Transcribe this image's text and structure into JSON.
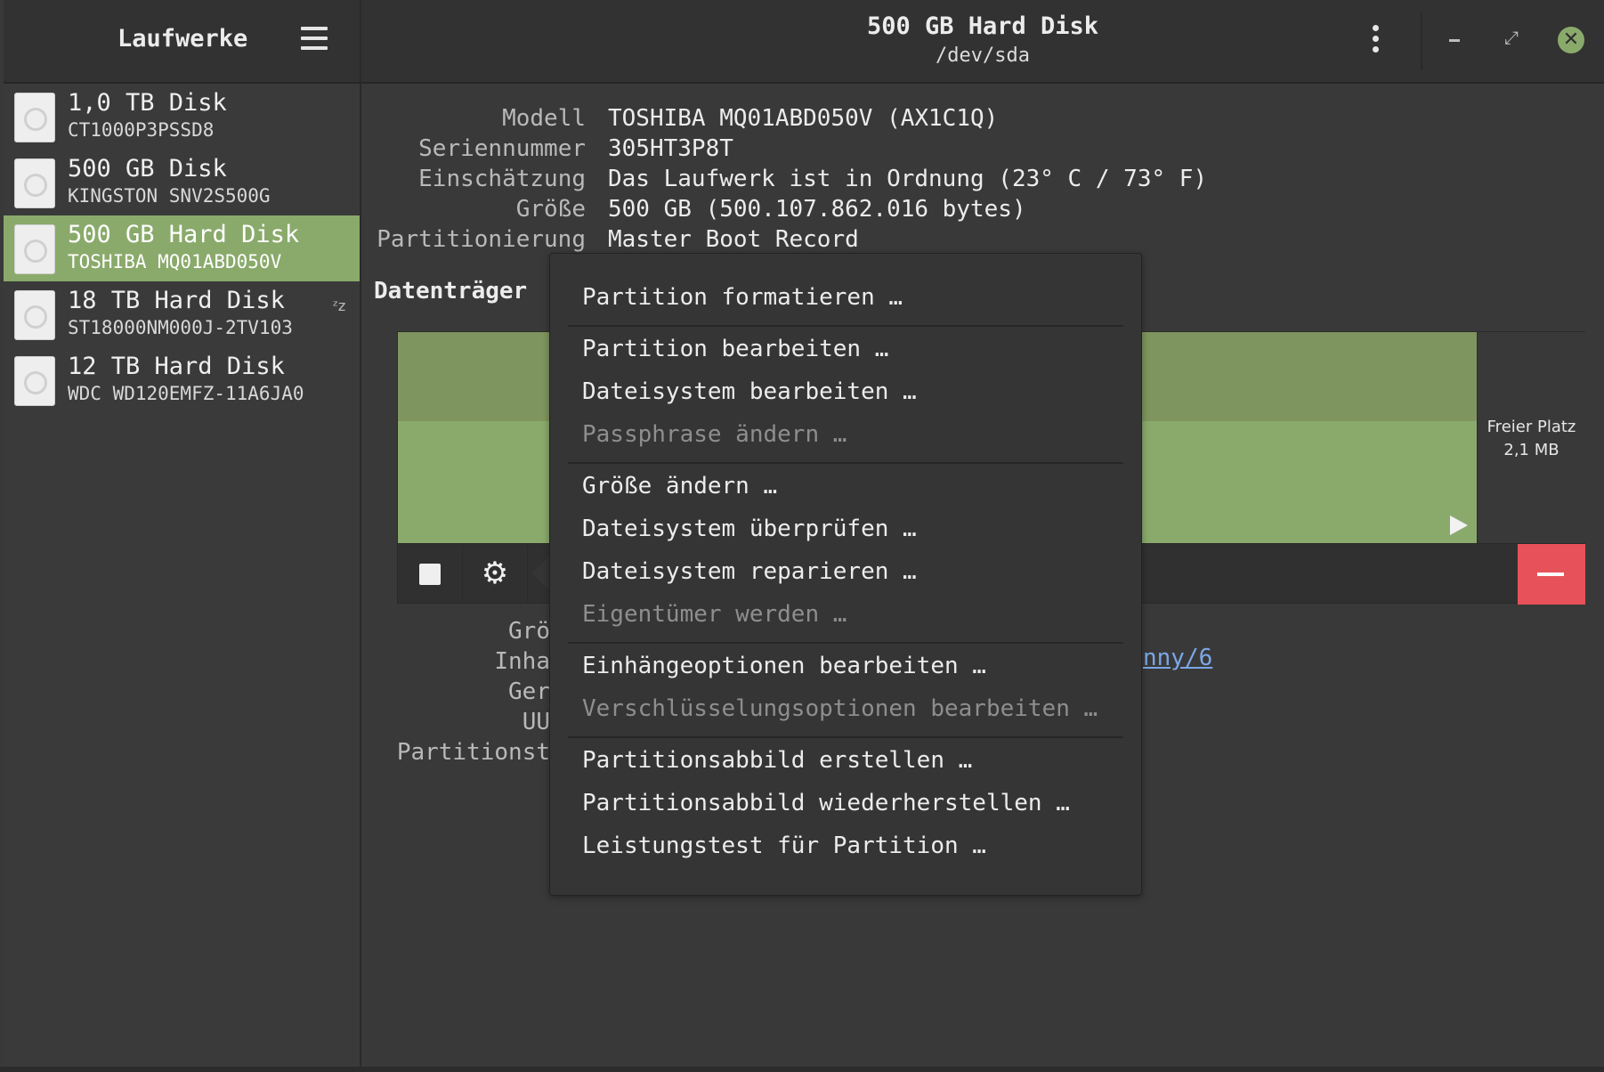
{
  "sidebar": {
    "title": "Laufwerke",
    "drives": [
      {
        "name": "1,0 TB Disk",
        "model": "CT1000P3PSSD8"
      },
      {
        "name": "500 GB Disk",
        "model": "KINGSTON SNV2S500G"
      },
      {
        "name": "500 GB Hard Disk",
        "model": "TOSHIBA MQ01ABD050V",
        "selected": true
      },
      {
        "name": "18 TB Hard Disk",
        "model": "ST18000NM000J-2TV103",
        "sleeping_indicator": "zzz"
      },
      {
        "name": "12 TB Hard Disk",
        "model": "WDC WD120EMFZ-11A6JA0"
      }
    ]
  },
  "header": {
    "title": "500 GB Hard Disk",
    "subtitle": "/dev/sda"
  },
  "info": {
    "labels": [
      "Modell",
      "Seriennummer",
      "Einschätzung",
      "Größe",
      "Partitionierung"
    ],
    "values": [
      "TOSHIBA MQ01ABD050V (AX1C1Q)",
      "305HT3P8T",
      "Das Laufwerk ist in Ordnung (23° C / 73° F)",
      "500 GB (500.107.862.016 bytes)",
      "Master Boot Record"
    ]
  },
  "volumes": {
    "heading": "Datenträger",
    "free_space_label": "Freier Platz",
    "free_space_size": "2,1 MB"
  },
  "partition_info": {
    "labels_partial": [
      "Grö",
      "Inha",
      "Ger",
      "UU",
      "Partitionst"
    ],
    "link_partial": "nny/6"
  },
  "context_menu": {
    "items": [
      {
        "label": "Partition formatieren …",
        "enabled": true
      },
      {
        "label": "Partition bearbeiten …",
        "enabled": true
      },
      {
        "label": "Dateisystem bearbeiten …",
        "enabled": true
      },
      {
        "label": "Passphrase ändern …",
        "enabled": false
      },
      {
        "label": "Größe ändern …",
        "enabled": true
      },
      {
        "label": "Dateisystem überprüfen …",
        "enabled": true
      },
      {
        "label": "Dateisystem reparieren …",
        "enabled": true
      },
      {
        "label": "Eigentümer werden …",
        "enabled": false
      },
      {
        "label": "Einhängeoptionen bearbeiten …",
        "enabled": true
      },
      {
        "label": "Verschlüsselungsoptionen bearbeiten …",
        "enabled": false
      },
      {
        "label": "Partitionsabbild erstellen …",
        "enabled": true
      },
      {
        "label": "Partitionsabbild wiederherstellen …",
        "enabled": true
      },
      {
        "label": "Leistungstest für Partition …",
        "enabled": true
      }
    ]
  },
  "colors": {
    "accent": "#8aaa6b",
    "danger": "#e7525a",
    "background": "#393939"
  }
}
